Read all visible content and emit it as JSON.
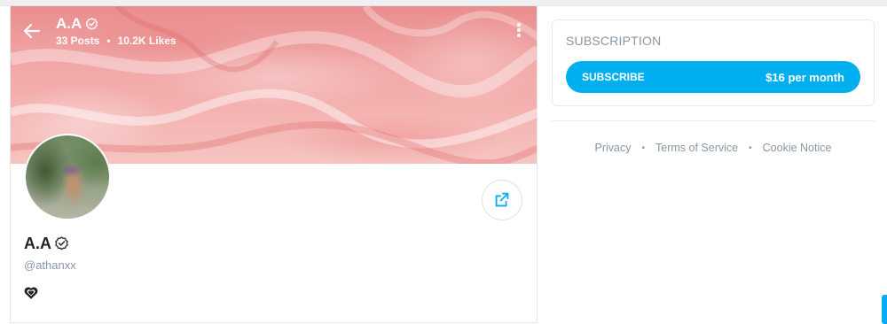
{
  "header": {
    "name": "A.A",
    "posts": "33 Posts",
    "likes": "10.2K Likes",
    "separator": "•"
  },
  "profile": {
    "name": "A.A",
    "handle": "@athanxx",
    "bio_icon": "heart-icon"
  },
  "subscription": {
    "title": "SUBSCRIPTION",
    "button_label": "SUBSCRIBE",
    "price": "$16 per month"
  },
  "footer": {
    "links": [
      "Privacy",
      "Terms of Service",
      "Cookie Notice"
    ],
    "separator": "•"
  },
  "colors": {
    "accent": "#00aff0",
    "muted_text": "#8a96a3",
    "cover": "#f1a6a6"
  }
}
